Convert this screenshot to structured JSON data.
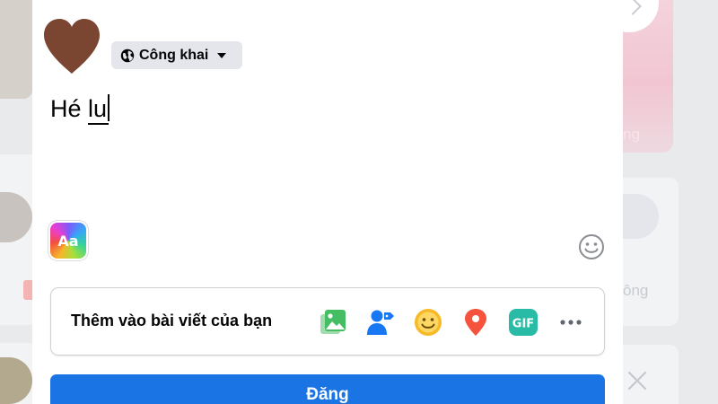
{
  "composer": {
    "audience_label": "Công khai",
    "text_prefix": "Hé ",
    "text_typed": "lu",
    "format_button_label": "Aa",
    "add_to_post_label": "Thêm vào bài viết của bạn",
    "post_button_label": "Đăng",
    "tools": [
      {
        "name": "photo-video-icon",
        "color": "#45bd62"
      },
      {
        "name": "tag-people-icon",
        "color": "#1877f2"
      },
      {
        "name": "feeling-icon",
        "color": "#f7b928"
      },
      {
        "name": "check-in-icon",
        "color": "#f5533d"
      },
      {
        "name": "gif-icon",
        "color": "#2abba7"
      },
      {
        "name": "more-icon",
        "color": "#606770"
      }
    ]
  },
  "background": {
    "story_text_fragment": "ng",
    "right_card_text_fragment": "ông"
  },
  "colors": {
    "primary_button": "#1b74e4",
    "avatar_heart": "#7b4631",
    "chip_background": "#e4e6eb"
  }
}
